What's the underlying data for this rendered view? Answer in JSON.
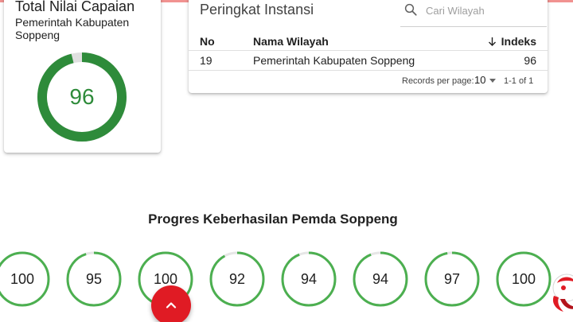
{
  "total_card": {
    "title": "Total Nilai Capaian",
    "subtitle": "Pemerintah Kabupaten Soppeng",
    "value": "96",
    "progress": 96,
    "ring_color": "#2e8b3a",
    "track_color": "#e0e0e0"
  },
  "ranking": {
    "title": "Peringkat Instansi",
    "search": {
      "placeholder": "Cari Wilayah",
      "value": ""
    },
    "columns": {
      "no": "No",
      "name": "Nama Wilayah",
      "index": "Indeks"
    },
    "rows": [
      {
        "no": "19",
        "name": "Pemerintah Kabupaten Soppeng",
        "index": "96"
      }
    ],
    "pagination": {
      "records_label": "Records per page:",
      "per_page": "10",
      "range": "1-1 of 1"
    }
  },
  "progress_section": {
    "title": "Progres Keberhasilan Pemda Soppeng",
    "ring_color": "#4caf50",
    "track_color": "#e6e6e6",
    "items": [
      {
        "value": "100",
        "progress": 100
      },
      {
        "value": "95",
        "progress": 95
      },
      {
        "value": "100",
        "progress": 100
      },
      {
        "value": "92",
        "progress": 92
      },
      {
        "value": "94",
        "progress": 94
      },
      {
        "value": "94",
        "progress": 94
      },
      {
        "value": "97",
        "progress": 97
      },
      {
        "value": "100",
        "progress": 100
      }
    ]
  },
  "fab": {
    "icon": "chevron-up-icon",
    "color": "#e01b24"
  },
  "mascot": {
    "icon": "mascot-icon",
    "color": "#e01b24"
  }
}
